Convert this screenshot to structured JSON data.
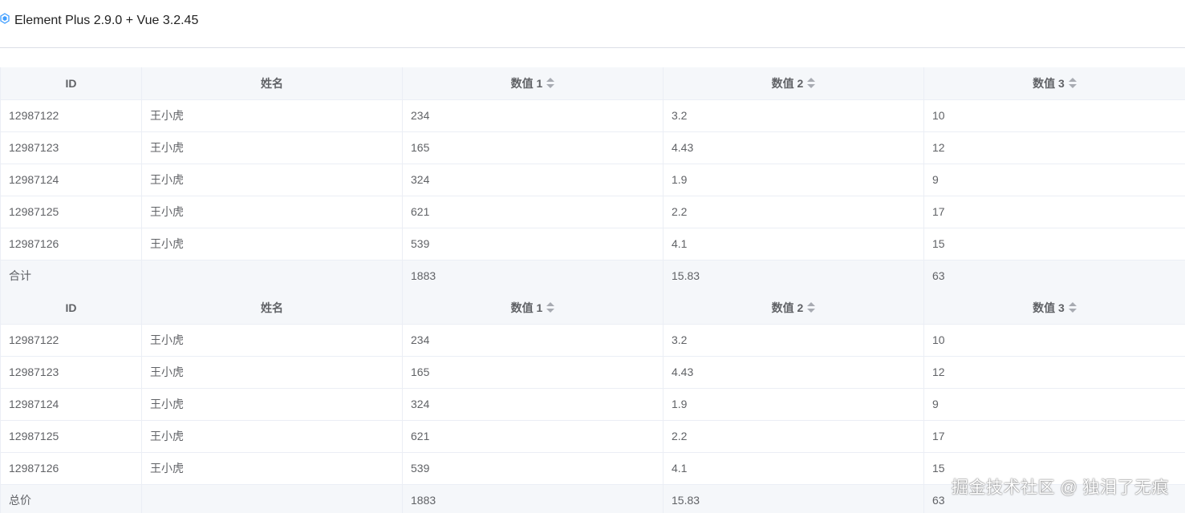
{
  "header": {
    "title": "Element Plus 2.9.0 + Vue 3.2.45",
    "icon": "vue-logo-icon"
  },
  "table1": {
    "columns": [
      "ID",
      "姓名",
      "数值 1",
      "数值 2",
      "数值 3"
    ],
    "rows": [
      [
        "12987122",
        "王小虎",
        "234",
        "3.2",
        "10"
      ],
      [
        "12987123",
        "王小虎",
        "165",
        "4.43",
        "12"
      ],
      [
        "12987124",
        "王小虎",
        "324",
        "1.9",
        "9"
      ],
      [
        "12987125",
        "王小虎",
        "621",
        "2.2",
        "17"
      ],
      [
        "12987126",
        "王小虎",
        "539",
        "4.1",
        "15"
      ]
    ],
    "footer": [
      "合计",
      "",
      "1883",
      "15.83",
      "63"
    ]
  },
  "table2": {
    "columns": [
      "ID",
      "姓名",
      "数值 1",
      "数值 2",
      "数值 3"
    ],
    "rows": [
      [
        "12987122",
        "王小虎",
        "234",
        "3.2",
        "10"
      ],
      [
        "12987123",
        "王小虎",
        "165",
        "4.43",
        "12"
      ],
      [
        "12987124",
        "王小虎",
        "324",
        "1.9",
        "9"
      ],
      [
        "12987125",
        "王小虎",
        "621",
        "2.2",
        "17"
      ],
      [
        "12987126",
        "王小虎",
        "539",
        "4.1",
        "15"
      ]
    ],
    "footer": [
      "总价",
      "",
      "1883",
      "15.83",
      "63"
    ]
  },
  "watermark": "掘金技术社区 @ 独泪了无痕",
  "colors": {
    "header_bg": "#f5f7fa",
    "border": "#ebeef5",
    "text": "#606266"
  }
}
